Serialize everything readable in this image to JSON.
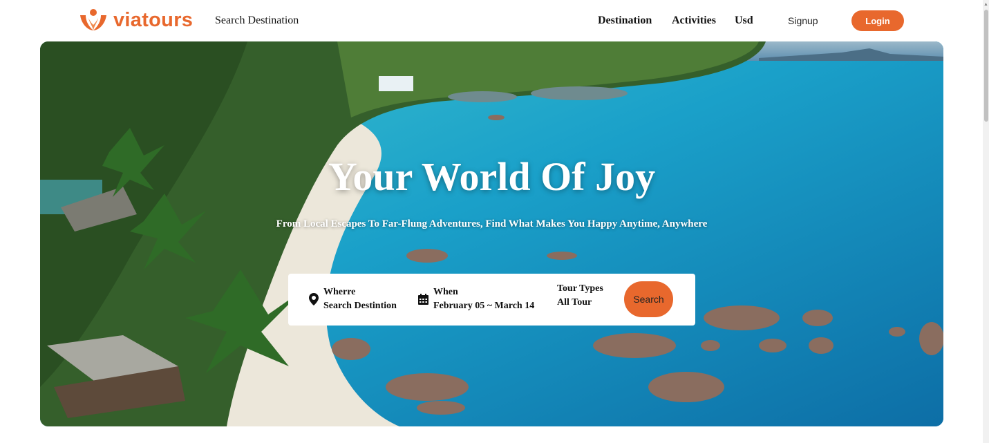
{
  "brand": {
    "name": "viatours",
    "color": "#e8682d"
  },
  "header": {
    "search_placeholder": "Search Destination",
    "nav": [
      "Destination",
      "Activities",
      "Usd"
    ],
    "signup": "Signup",
    "login": "Login"
  },
  "hero": {
    "title": "Your World Of Joy",
    "subtitle": "From Local Escapes To Far-Flung Adventures, Find What Makes You Happy Anytime, Anywhere"
  },
  "search": {
    "where": {
      "label": "Wherre",
      "value": "Search Destintion",
      "icon": "location-pin-icon"
    },
    "when": {
      "label": "When",
      "value": "February 05 ~ March 14",
      "icon": "calendar-icon"
    },
    "tour": {
      "label": "Tour Types",
      "value": "All Tour"
    },
    "button": "Search"
  }
}
